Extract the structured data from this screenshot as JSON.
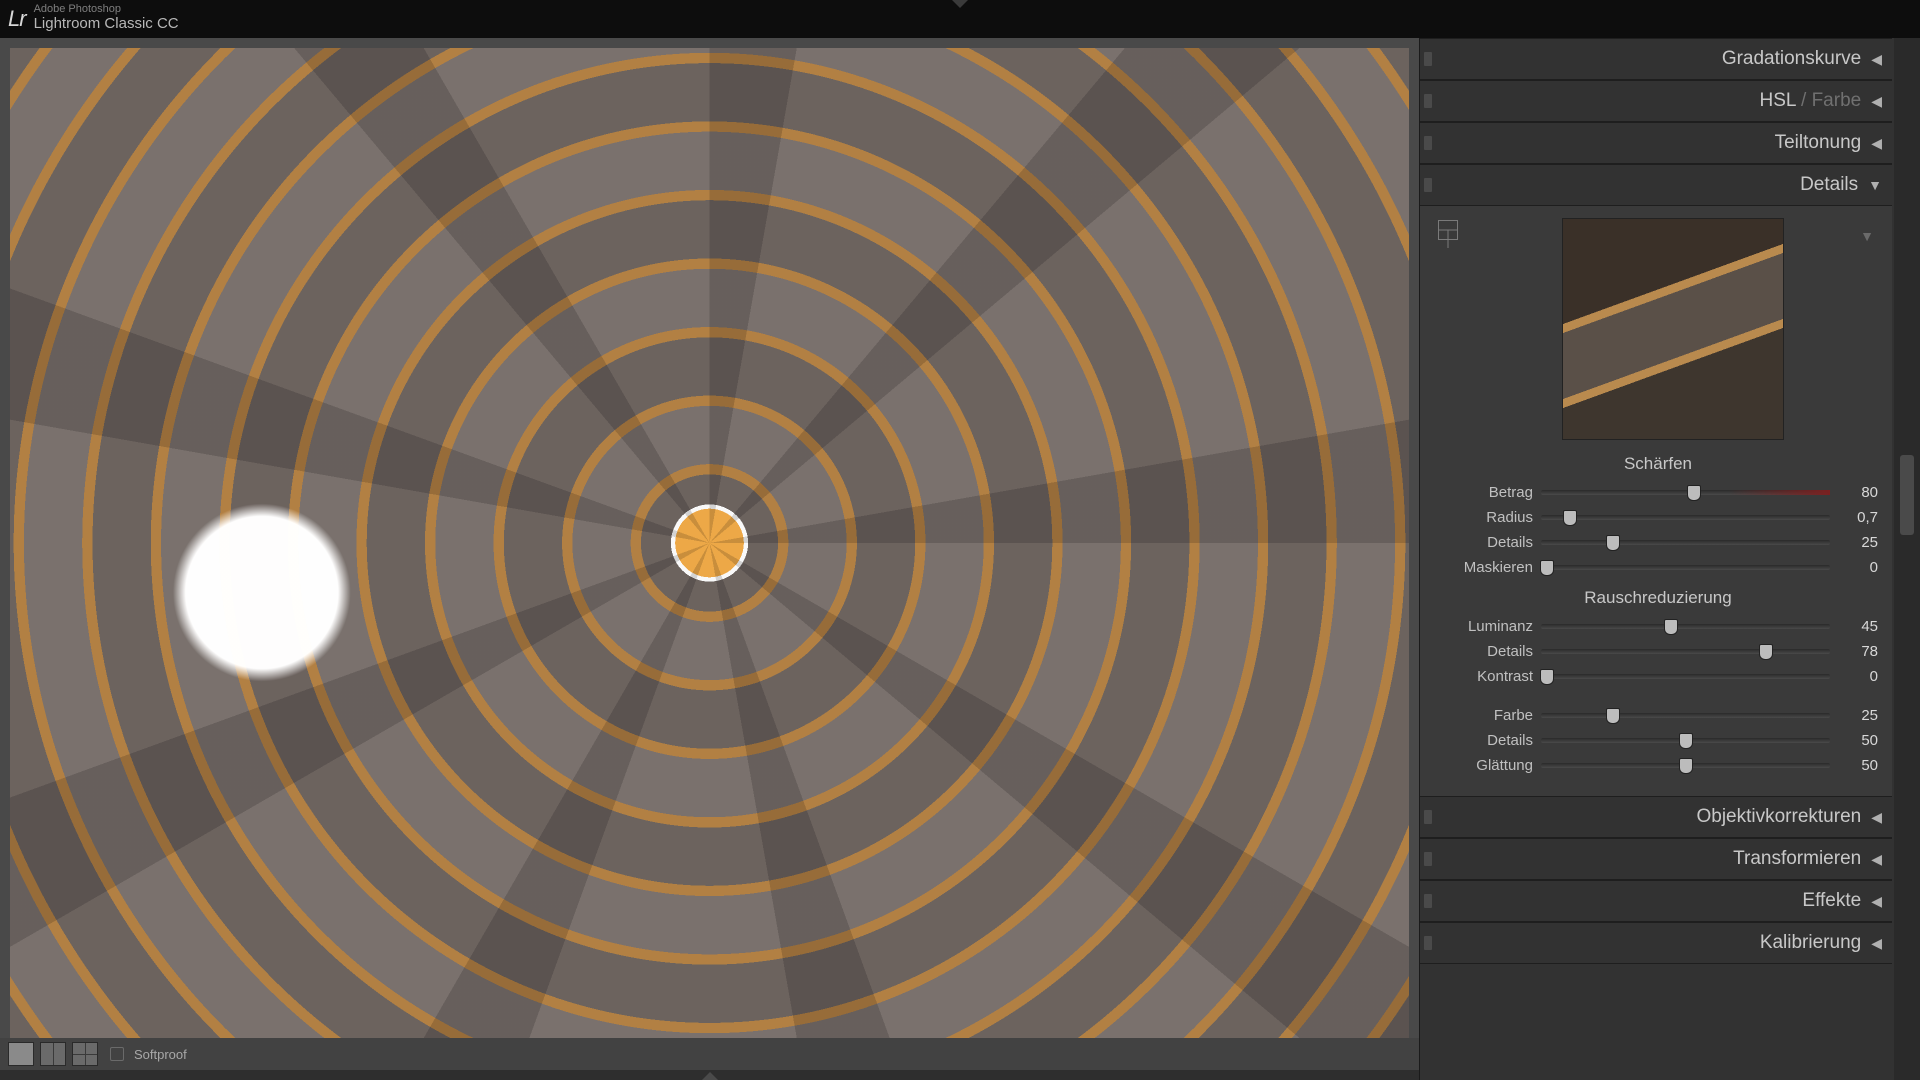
{
  "app": {
    "publisher": "Adobe Photoshop",
    "name": "Lightroom Classic CC",
    "logo": "Lr"
  },
  "toolbar": {
    "softproof": "Softproof"
  },
  "panels": {
    "gradation": "Gradationskurve",
    "hsl": "HSL",
    "farbe": "Farbe",
    "teiltonung": "Teiltonung",
    "details": "Details",
    "objektiv": "Objektivkorrekturen",
    "transform": "Transformieren",
    "effekte": "Effekte",
    "kalibrierung": "Kalibrierung"
  },
  "details": {
    "sharpen": {
      "title": "Schärfen",
      "betrag": {
        "label": "Betrag",
        "value": "80",
        "pos": 53
      },
      "radius": {
        "label": "Radius",
        "value": "0,7",
        "pos": 10
      },
      "details": {
        "label": "Details",
        "value": "25",
        "pos": 25
      },
      "maskieren": {
        "label": "Maskieren",
        "value": "0",
        "pos": 2
      }
    },
    "noise": {
      "title": "Rauschreduzierung",
      "luminanz": {
        "label": "Luminanz",
        "value": "45",
        "pos": 45
      },
      "ldetails": {
        "label": "Details",
        "value": "78",
        "pos": 78
      },
      "kontrast": {
        "label": "Kontrast",
        "value": "0",
        "pos": 2
      },
      "farbe": {
        "label": "Farbe",
        "value": "25",
        "pos": 25
      },
      "cdetails": {
        "label": "Details",
        "value": "50",
        "pos": 50
      },
      "glaettung": {
        "label": "Glättung",
        "value": "50",
        "pos": 50
      }
    }
  }
}
